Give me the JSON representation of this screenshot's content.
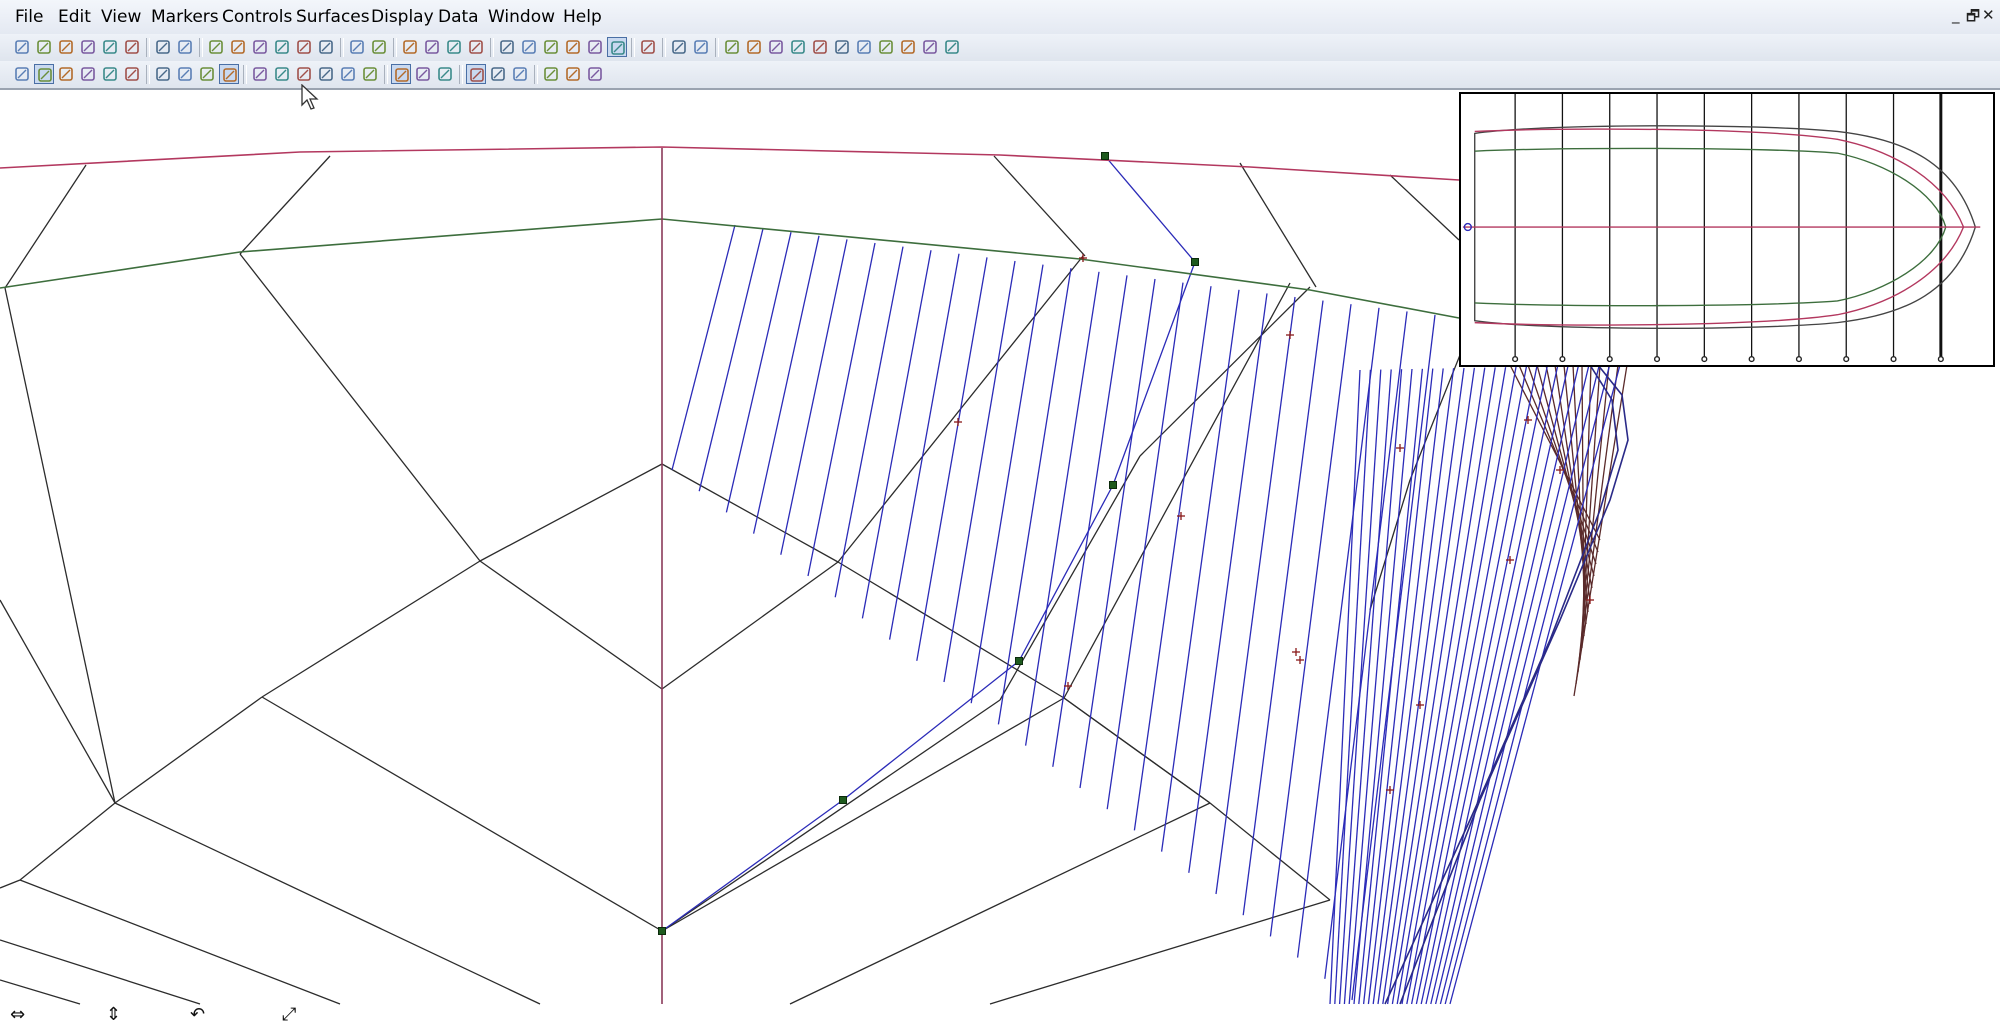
{
  "menubar": {
    "items": [
      "File",
      "Edit",
      "View",
      "Markers",
      "Controls",
      "Surfaces",
      "Display",
      "Data",
      "Window",
      "Help"
    ],
    "window_controls": [
      "_",
      "🗗",
      "✕"
    ]
  },
  "toolbar1": {
    "icons": [
      "new-file-icon",
      "open-folder-icon",
      "save-icon",
      "cut-icon",
      "copy-icon",
      "paste-icon",
      "print-icon",
      "help-icon",
      "zoom-in-icon",
      "zoom-out-icon",
      "pan-icon",
      "home-icon",
      "rotate-icon",
      "select-icon",
      "undo-icon",
      "redo-icon",
      "markers-icon",
      "flowlines-icon",
      "net-icon",
      "marker-remove-icon",
      "delete-icon",
      "intersect-icon",
      "link-icon",
      "curve-icon",
      "xx-icon",
      "bend-icon",
      "grid-icon",
      "pencil-icon",
      "compass-icon",
      "snap-icon",
      "nodes-icon",
      "align-icon",
      "fair-icon",
      "extend-icon",
      "trim-icon",
      "cross-icon",
      "mirror-icon",
      "break-icon",
      "group-icon",
      "copy-surface-icon"
    ]
  },
  "toolbar2": {
    "icons": [
      "sphere-icon",
      "filter-icon",
      "left-arrow-icon",
      "triangle-icon",
      "right-arrow-icon",
      "wand-icon",
      "layer-1-icon",
      "layer-2-icon",
      "layer-3-icon",
      "layer-4-icon",
      "xx-marker-icon",
      "table-icon",
      "wave-icon",
      "curvature-icon",
      "spreadsheet-icon",
      "sigma-icon",
      "surface-view-icon",
      "surface-edit-icon",
      "surface-tools-icon",
      "panel-1-icon",
      "panel-2-icon",
      "panel-3-icon",
      "rotate-3d-icon",
      "shape-1-icon",
      "shape-2-icon"
    ]
  },
  "status_strip": {
    "icons": [
      "horizontal-move-icon",
      "vertical-move-icon",
      "rotate-view-icon",
      "resize-view-icon"
    ]
  },
  "colors": {
    "sheer_line": "#b3385f",
    "chine_line": "#3d6e3d",
    "control_net": "#2c2c2c",
    "control_polygon": "#2b2bb8",
    "centerline": "#8a3a5a",
    "marker": "#8a1a1a"
  }
}
